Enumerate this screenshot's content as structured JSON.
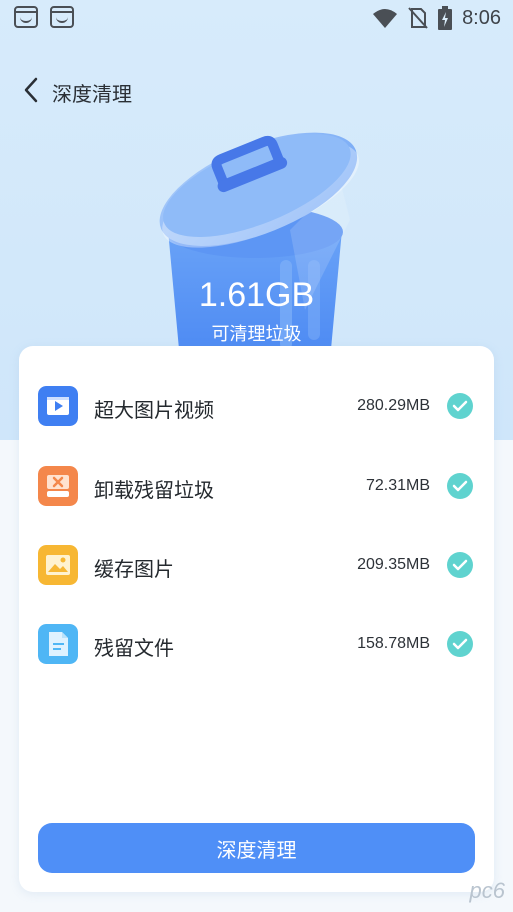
{
  "status_bar": {
    "time": "8:06",
    "icons": [
      "app-notification-icon",
      "app-notification-icon",
      "wifi-icon",
      "no-sim-icon",
      "battery-charging-icon"
    ]
  },
  "header": {
    "title": "深度清理",
    "back_icon": "chevron-left-icon"
  },
  "summary": {
    "size": "1.61GB",
    "caption": "可清理垃圾"
  },
  "items": [
    {
      "label": "超大图片视频",
      "size": "280.29MB",
      "icon": "video-icon",
      "color": "#3f7ff2",
      "checked": true
    },
    {
      "label": "卸载残留垃圾",
      "size": "72.31MB",
      "icon": "uninstall-trash-icon",
      "color": "#f4874b",
      "checked": true
    },
    {
      "label": "缓存图片",
      "size": "209.35MB",
      "icon": "image-icon",
      "color": "#f7b733",
      "checked": true
    },
    {
      "label": "残留文件",
      "size": "158.78MB",
      "icon": "file-icon",
      "color": "#4fb6f5",
      "checked": true
    }
  ],
  "action": {
    "button_label": "深度清理"
  },
  "colors": {
    "accent": "#4f8ff7",
    "check": "#5fd3cf"
  },
  "watermark": "pc6"
}
